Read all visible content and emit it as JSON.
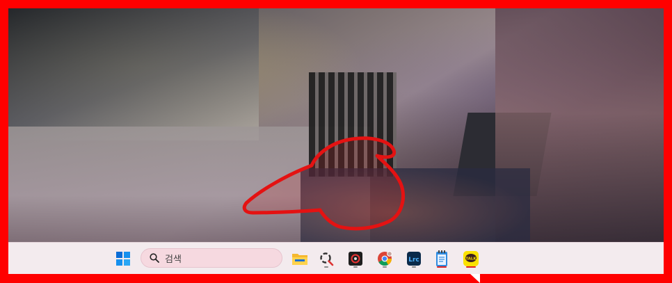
{
  "taskbar": {
    "search_placeholder": "검색",
    "apps": [
      {
        "name": "windows-start",
        "icon": "windows-logo-icon"
      },
      {
        "name": "file-explorer",
        "icon": "folder-icon"
      },
      {
        "name": "search-app",
        "icon": "spinner-search-icon"
      },
      {
        "name": "camera-app",
        "icon": "camera-icon"
      },
      {
        "name": "chrome",
        "icon": "chrome-icon"
      },
      {
        "name": "lightroom-classic",
        "icon": "lrc-icon",
        "label": "Lrc"
      },
      {
        "name": "notepad",
        "icon": "notepad-icon"
      },
      {
        "name": "kakaotalk",
        "icon": "kakaotalk-icon",
        "label": "TALK"
      }
    ]
  },
  "colors": {
    "border": "#ff0000",
    "taskbar_bg": "#f3ebee",
    "annotation": "#e41212"
  }
}
